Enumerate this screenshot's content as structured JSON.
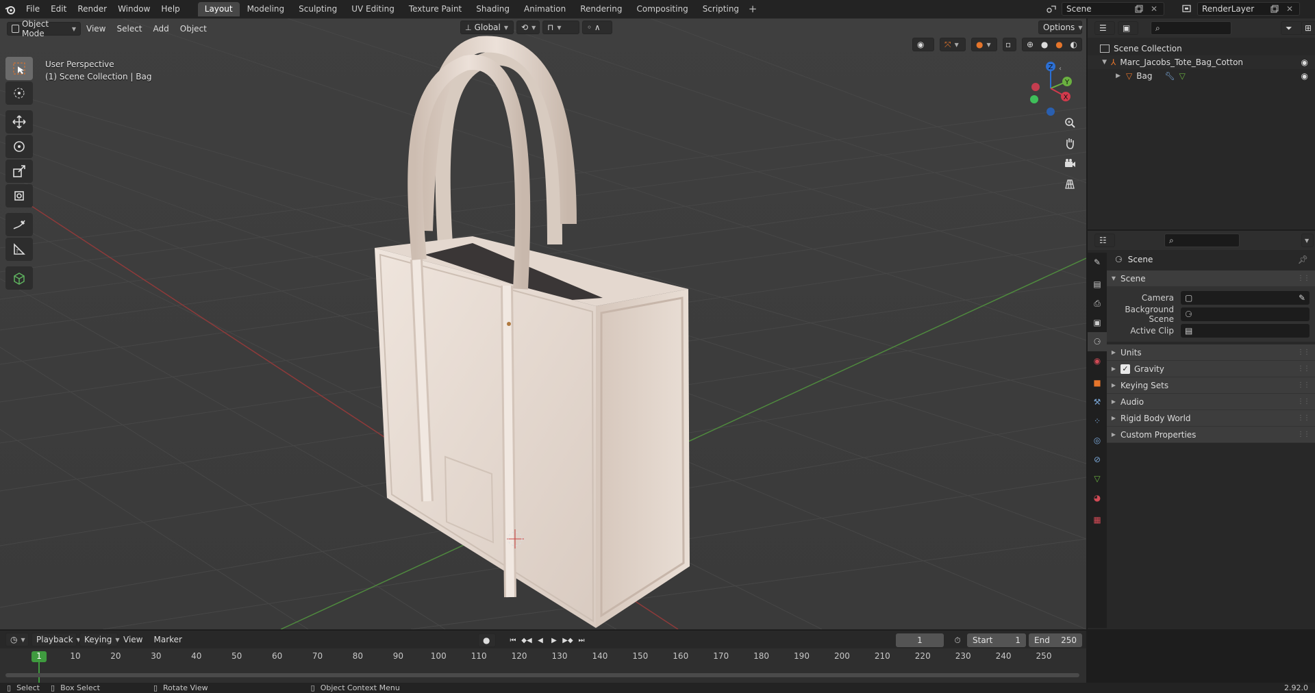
{
  "menu": [
    "File",
    "Edit",
    "Render",
    "Window",
    "Help"
  ],
  "workspaces": [
    {
      "label": "Layout",
      "active": true
    },
    {
      "label": "Modeling",
      "active": false
    },
    {
      "label": "Sculpting",
      "active": false
    },
    {
      "label": "UV Editing",
      "active": false
    },
    {
      "label": "Texture Paint",
      "active": false
    },
    {
      "label": "Shading",
      "active": false
    },
    {
      "label": "Animation",
      "active": false
    },
    {
      "label": "Rendering",
      "active": false
    },
    {
      "label": "Compositing",
      "active": false
    },
    {
      "label": "Scripting",
      "active": false
    }
  ],
  "add_workspace": "+",
  "scene_name": "Scene",
  "view_layer_name": "RenderLayer",
  "viewport": {
    "mode": "Object Mode",
    "menus": [
      "View",
      "Select",
      "Add",
      "Object"
    ],
    "transform_orientation": "Global",
    "options_label": "Options",
    "info_line1": "User Perspective",
    "info_line2": "(1) Scene Collection | Bag",
    "gizmo": {
      "z": "Z",
      "y": "Y",
      "x": "X"
    }
  },
  "outliner": {
    "root": "Scene Collection",
    "collection": "Marc_Jacobs_Tote_Bag_Cotton",
    "object": "Bag"
  },
  "properties": {
    "header_title": "Scene",
    "panel_title": "Scene",
    "camera_label": "Camera",
    "background_label": "Background Scene",
    "clip_label": "Active Clip",
    "subpanels": [
      "Units",
      "Gravity",
      "Keying Sets",
      "Audio",
      "Rigid Body World",
      "Custom Properties"
    ],
    "gravity_checked": true
  },
  "timeline": {
    "menus": [
      "Playback",
      "Keying",
      "View",
      "Marker"
    ],
    "current_frame": "1",
    "start_label": "Start",
    "start_value": "1",
    "end_label": "End",
    "end_value": "250",
    "ticks": [
      "1",
      "10",
      "20",
      "30",
      "40",
      "50",
      "60",
      "70",
      "80",
      "90",
      "100",
      "110",
      "120",
      "130",
      "140",
      "150",
      "160",
      "170",
      "180",
      "190",
      "200",
      "210",
      "220",
      "230",
      "240",
      "250"
    ]
  },
  "statusbar": {
    "select": "Select",
    "box_select": "Box Select",
    "rotate_view": "Rotate View",
    "context_menu": "Object Context Menu",
    "version": "2.92.0"
  },
  "colors": {
    "accent_orange": "#e5752b",
    "active_frame_green": "#3f9b3f",
    "viewport_bg": "#3d3d3d",
    "bag_leather": "#e8dcd3"
  }
}
